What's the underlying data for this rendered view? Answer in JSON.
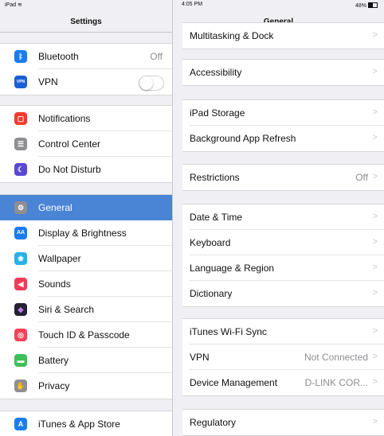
{
  "status_bar": {
    "carrier": "iPad",
    "time": "4:05 PM",
    "battery": "48%"
  },
  "sidebar": {
    "title": "Settings",
    "groups": [
      [
        {
          "label": "Bluetooth",
          "value": "Off",
          "icon": "bluetooth-icon",
          "color": "#1a7cf5"
        },
        {
          "label": "VPN",
          "icon": "vpn-icon",
          "color": "#1a5fd6",
          "toggle": "off"
        }
      ],
      [
        {
          "label": "Notifications",
          "icon": "notifications-icon",
          "color": "#f23b30"
        },
        {
          "label": "Control Center",
          "icon": "control-center-icon",
          "color": "#8e8e93"
        },
        {
          "label": "Do Not Disturb",
          "icon": "moon-icon",
          "color": "#5a48d4"
        }
      ],
      [
        {
          "label": "General",
          "icon": "gear-icon",
          "color": "#8e8e93",
          "selected": true
        },
        {
          "label": "Display & Brightness",
          "icon": "display-icon",
          "color": "#1a7cf5"
        },
        {
          "label": "Wallpaper",
          "icon": "wallpaper-icon",
          "color": "#2cb0e8"
        },
        {
          "label": "Sounds",
          "icon": "speaker-icon",
          "color": "#f23b5a"
        },
        {
          "label": "Siri & Search",
          "icon": "siri-icon",
          "color": "#222233"
        },
        {
          "label": "Touch ID & Passcode",
          "icon": "fingerprint-icon",
          "color": "#f2435a"
        },
        {
          "label": "Battery",
          "icon": "battery-icon",
          "color": "#3fbf5a"
        },
        {
          "label": "Privacy",
          "icon": "hand-icon",
          "color": "#8e8e93"
        }
      ],
      [
        {
          "label": "iTunes & App Store",
          "icon": "app-store-icon",
          "color": "#1a7cf5"
        }
      ]
    ]
  },
  "main": {
    "title": "General",
    "partial_row": "Multitasking & Dock",
    "groups": [
      [
        {
          "label": "Accessibility"
        }
      ],
      [
        {
          "label": "iPad Storage"
        },
        {
          "label": "Background App Refresh"
        }
      ],
      [
        {
          "label": "Restrictions",
          "value": "Off"
        }
      ],
      [
        {
          "label": "Date & Time"
        },
        {
          "label": "Keyboard"
        },
        {
          "label": "Language & Region"
        },
        {
          "label": "Dictionary"
        }
      ],
      [
        {
          "label": "iTunes Wi-Fi Sync"
        },
        {
          "label": "VPN",
          "value": "Not Connected"
        },
        {
          "label": "Device Management",
          "value": "D-LINK COR..."
        }
      ],
      [
        {
          "label": "Regulatory"
        }
      ]
    ]
  }
}
